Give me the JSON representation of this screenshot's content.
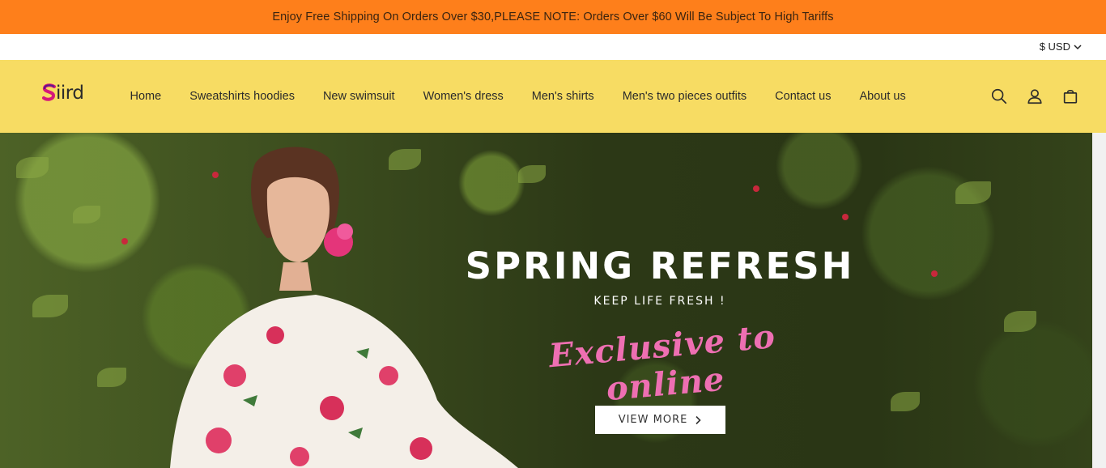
{
  "announcement": {
    "text": "Enjoy Free Shipping On Orders Over $30,PLEASE NOTE: Orders Over $60 Will Be Subject To High Tariffs"
  },
  "currency": {
    "label": "$ USD",
    "icon": "chevron-down-icon"
  },
  "brand": {
    "name": "iird",
    "logo_mark_color": "#d6177a"
  },
  "nav": {
    "items": [
      {
        "label": "Home"
      },
      {
        "label": "Sweatshirts hoodies"
      },
      {
        "label": "New swimsuit"
      },
      {
        "label": "Women's dress"
      },
      {
        "label": "Men's shirts"
      },
      {
        "label": "Men's two pieces outfits"
      },
      {
        "label": "Contact us"
      },
      {
        "label": "About us"
      }
    ]
  },
  "header_icons": [
    "search-icon",
    "account-icon",
    "cart-icon"
  ],
  "hero": {
    "title": "SPRING REFRESH",
    "subtitle": "KEEP LIFE FRESH !",
    "tagline": "Exclusive to online",
    "button_label": "VIEW MORE"
  },
  "colors": {
    "announcement_bg": "#fe7f1b",
    "header_bg": "#f7dc63",
    "accent_pink": "#ee6fb2"
  }
}
